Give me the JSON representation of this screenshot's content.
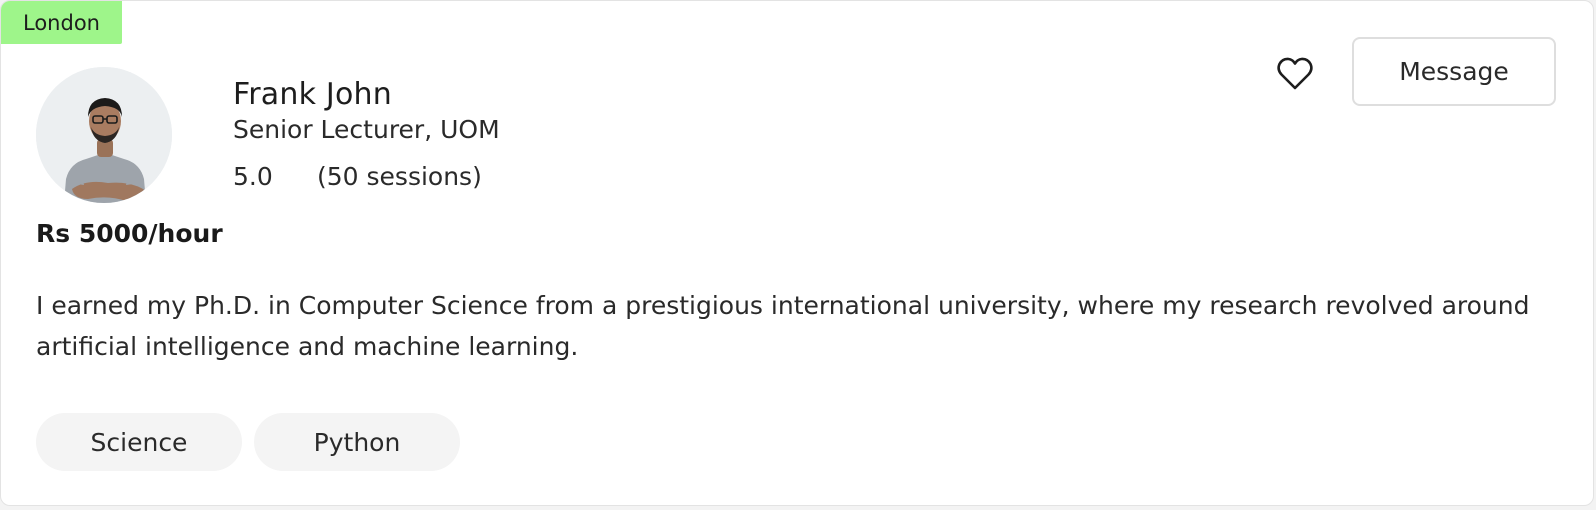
{
  "location": "London",
  "tutor": {
    "name": "Frank John",
    "title": "Senior Lecturer, UOM",
    "rating": "5.0",
    "sessions": "(50 sessions)",
    "price": "Rs 5000/hour",
    "bio": "I earned my Ph.D. in Computer Science from a prestigious international university, where my research revolved around artificial intelligence and machine learning."
  },
  "actions": {
    "favorite_icon": "heart-icon",
    "message_label": "Message"
  },
  "tags": [
    "Science",
    "Python"
  ],
  "colors": {
    "badge": "#9ef58a",
    "tag_bg": "#f4f4f4",
    "border": "#dedede"
  }
}
